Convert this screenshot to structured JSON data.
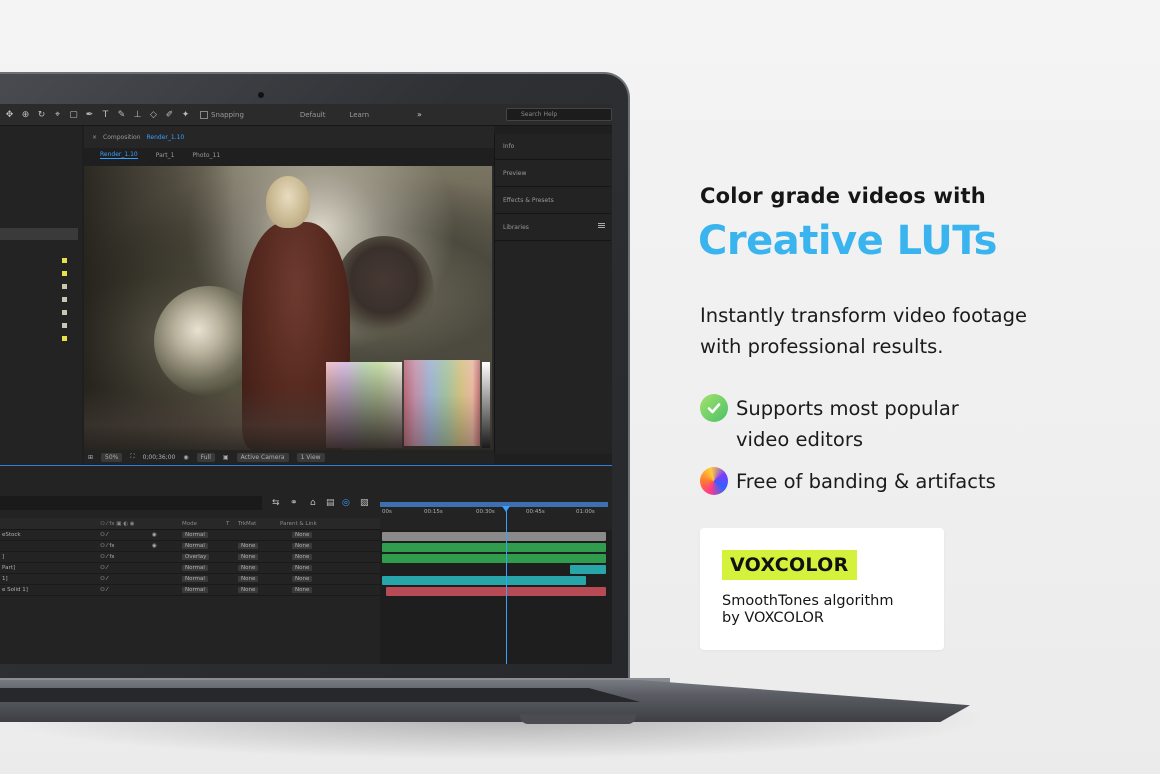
{
  "hero": {
    "tagline": "Color grade videos with",
    "title": "Creative LUTs",
    "description_line1": "Instantly transform video footage",
    "description_line2": "with professional results.",
    "features": [
      {
        "line1": "Supports most popular",
        "line2": "video editors",
        "icon": "check-circle-icon"
      },
      {
        "line1": "Free of banding & artifacts",
        "line2": "",
        "icon": "gradient-circle-icon"
      }
    ],
    "accent_color": "#3ab4ef"
  },
  "brand": {
    "badge": "VOXCOLOR",
    "badge_color": "#d4f23b",
    "sub_line1": "SmoothTones algorithm",
    "sub_line2": "by VOXCOLOR"
  },
  "ae": {
    "toolbar": {
      "snapping": "Snapping",
      "workspace_default": "Default",
      "workspace_learn": "Learn",
      "search_placeholder": "Search Help"
    },
    "composition": {
      "label": "Composition",
      "name": "Render_1.10",
      "tabs": [
        "Render_1.10",
        "Part_1",
        "Photo_11"
      ]
    },
    "viewer_footer": {
      "zoom": "50%",
      "timecode": "0;00;36;00",
      "resolution": "Full",
      "camera": "Active Camera",
      "view": "1 View"
    },
    "right_panel": [
      "Info",
      "Preview",
      "Effects & Presets",
      "Libraries"
    ],
    "timeline": {
      "headers": {
        "mode": "Mode",
        "t": "T",
        "trkmat": "TrkMat",
        "parent": "Parent & Link"
      },
      "rows": [
        {
          "name": "eStock",
          "mode": "Normal",
          "trkmat": "",
          "parent": "None"
        },
        {
          "name": "",
          "mode": "Normal",
          "trkmat": "None",
          "parent": "None"
        },
        {
          "name": "]",
          "mode": "Overlay",
          "trkmat": "None",
          "parent": "None"
        },
        {
          "name": "Part]",
          "mode": "Normal",
          "trkmat": "None",
          "parent": "None"
        },
        {
          "name": "1]",
          "mode": "Normal",
          "trkmat": "None",
          "parent": "None"
        },
        {
          "name": "e Solid 1]",
          "mode": "Normal",
          "trkmat": "None",
          "parent": "None"
        }
      ],
      "ruler": [
        "00s",
        "00:15s",
        "00:30s",
        "00:45s",
        "01:00s"
      ]
    }
  }
}
